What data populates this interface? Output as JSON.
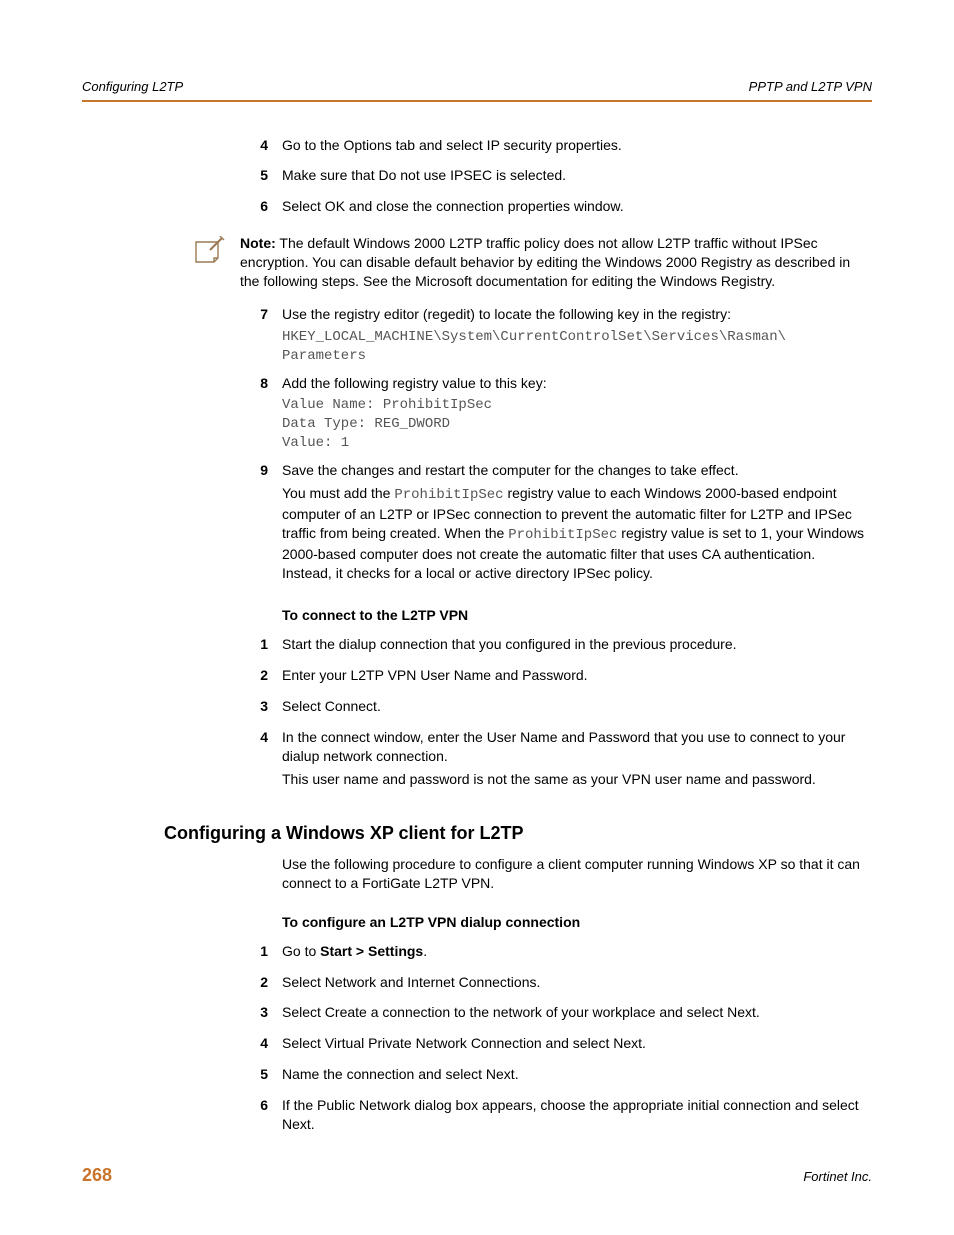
{
  "header": {
    "left": "Configuring L2TP",
    "right": "PPTP and L2TP VPN"
  },
  "stepsA": {
    "items": [
      {
        "num": "4",
        "text": "Go to the Options tab and select IP security properties."
      },
      {
        "num": "5",
        "text": "Make sure that Do not use IPSEC is selected."
      },
      {
        "num": "6",
        "text": "Select OK and close the connection properties window."
      }
    ]
  },
  "note": {
    "label": "Note:",
    "text": "The default Windows 2000 L2TP traffic policy does not allow L2TP traffic without IPSec encryption. You can disable default behavior by editing the Windows 2000 Registry as described in the following steps. See the Microsoft documentation for editing the Windows Registry."
  },
  "step7": {
    "num": "7",
    "lead": "Use the registry editor (regedit) to locate the following key in the registry:",
    "code": "HKEY_LOCAL_MACHINE\\System\\CurrentControlSet\\Services\\Rasman\\ Parameters"
  },
  "step8": {
    "num": "8",
    "lead": "Add the following registry value to this key:",
    "code": "Value Name: ProhibitIpSec\nData Type: REG_DWORD\nValue: 1"
  },
  "step9": {
    "num": "9",
    "lead": "Save the changes and restart the computer for the changes to take effect.",
    "para_pre": "You must add the ",
    "code1": "ProhibitIpSec",
    "para_mid": " registry value to each Windows 2000-based endpoint computer of an L2TP or IPSec connection to prevent the automatic filter for L2TP and IPSec traffic from being created. When the ",
    "code2": "ProhibitIpSec",
    "para_post": " registry value is set to 1, your Windows 2000-based computer does not create the automatic filter that uses CA authentication. Instead, it checks for a local or active directory IPSec policy."
  },
  "subheadB": "To connect to the L2TP VPN",
  "stepsB": {
    "items": [
      {
        "num": "1",
        "text": "Start the dialup connection that you configured in the previous procedure."
      },
      {
        "num": "2",
        "text": "Enter your L2TP VPN User Name and Password."
      },
      {
        "num": "3",
        "text": "Select Connect."
      },
      {
        "num": "4",
        "text": "In the connect window, enter the User Name and Password that you use to connect to your dialup network connection.",
        "text2": "This user name and password is not the same as your VPN user name and password."
      }
    ]
  },
  "sectionC": {
    "title": "Configuring a Windows XP client for L2TP",
    "intro": "Use the following procedure to configure a client computer running Windows XP so that it can connect to a FortiGate L2TP VPN.",
    "subhead": "To configure an L2TP VPN dialup connection",
    "items": [
      {
        "num": "1",
        "pre": "Go to ",
        "bold": "Start > Settings",
        "post": "."
      },
      {
        "num": "2",
        "text": "Select Network and Internet Connections."
      },
      {
        "num": "3",
        "text": "Select Create a connection to the network of your workplace and select Next."
      },
      {
        "num": "4",
        "text": "Select Virtual Private Network Connection and select Next."
      },
      {
        "num": "5",
        "text": "Name the connection and select Next."
      },
      {
        "num": "6",
        "text": "If the Public Network dialog box appears, choose the appropriate initial connection and select Next."
      }
    ]
  },
  "footer": {
    "page": "268",
    "publisher": "Fortinet Inc."
  }
}
